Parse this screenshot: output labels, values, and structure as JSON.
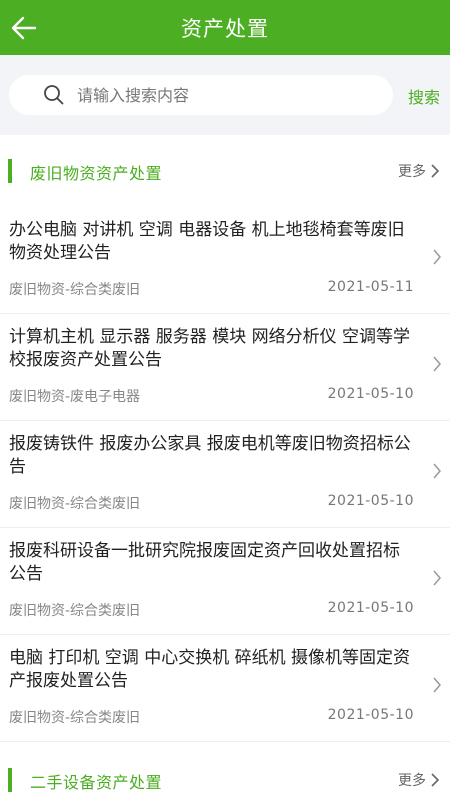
{
  "header": {
    "title": "资产处置"
  },
  "search": {
    "placeholder": "请输入搜索内容",
    "button_label": "搜索"
  },
  "sections": [
    {
      "title": "废旧物资资产处置",
      "more_label": "更多",
      "items": [
        {
          "title": "办公电脑 对讲机 空调 电器设备 机上地毯椅套等废旧物资处理公告",
          "category": "废旧物资-综合类废旧",
          "date": "2021-05-11"
        },
        {
          "title": "计算机主机 显示器 服务器 模块 网络分析仪 空调等学校报废资产处置公告",
          "category": "废旧物资-废电子电器",
          "date": "2021-05-10"
        },
        {
          "title": "报废铸铁件 报废办公家具 报废电机等废旧物资招标公告",
          "category": "废旧物资-综合类废旧",
          "date": "2021-05-10"
        },
        {
          "title": "报废科研设备一批研究院报废固定资产回收处置招标公告",
          "category": "废旧物资-综合类废旧",
          "date": "2021-05-10"
        },
        {
          "title": "电脑 打印机 空调 中心交换机 碎纸机 摄像机等固定资产报废处置公告",
          "category": "废旧物资-综合类废旧",
          "date": "2021-05-10"
        }
      ]
    },
    {
      "title": "二手设备资产处置",
      "more_label": "更多"
    }
  ],
  "colors": {
    "brand_green": "#4cae22",
    "background": "#f2f4f8"
  }
}
